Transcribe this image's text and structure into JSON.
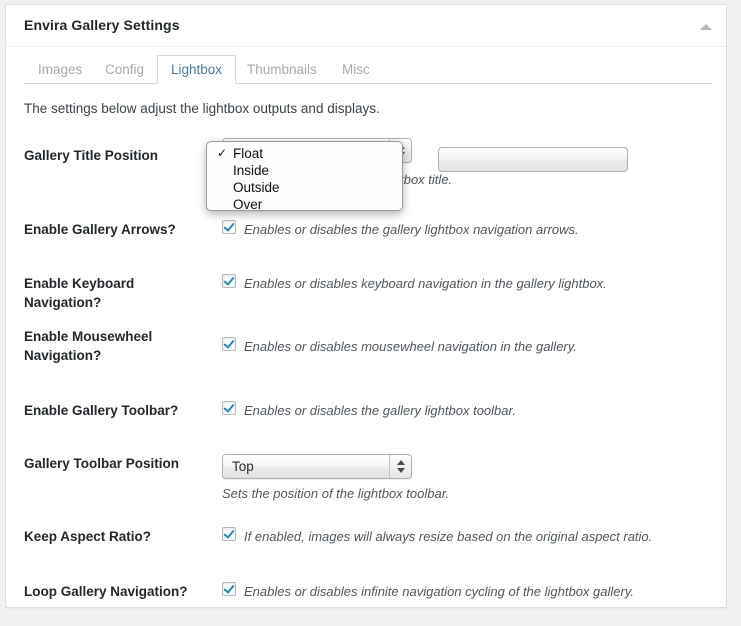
{
  "panel": {
    "title": "Envira Gallery Settings",
    "toggle_icon": "collapse-triangle-up-icon"
  },
  "tabs": [
    {
      "label": "Images",
      "active": false
    },
    {
      "label": "Config",
      "active": false
    },
    {
      "label": "Lightbox",
      "active": true
    },
    {
      "label": "Thumbnails",
      "active": false
    },
    {
      "label": "Misc",
      "active": false
    }
  ],
  "intro": "The settings below adjust the lightbox outputs and displays.",
  "settings": [
    {
      "label": "Gallery Title Position",
      "type": "select-open",
      "value": "Float",
      "hint": "Sets the position of the lightbox title.",
      "options": [
        {
          "label": "Float",
          "selected": true
        },
        {
          "label": "Inside",
          "selected": false
        },
        {
          "label": "Outside",
          "selected": false
        },
        {
          "label": "Over",
          "selected": false
        }
      ]
    },
    {
      "label": "Enable Gallery Arrows?",
      "type": "checkbox",
      "checked": true,
      "hint": "Enables or disables the gallery lightbox navigation arrows."
    },
    {
      "label": "Enable Keyboard Navigation?",
      "type": "checkbox",
      "checked": true,
      "hint": "Enables or disables keyboard navigation in the gallery lightbox."
    },
    {
      "label": "Enable Mousewheel Navigation?",
      "type": "checkbox",
      "checked": true,
      "hint": "Enables or disables mousewheel navigation in the gallery."
    },
    {
      "label": "Enable Gallery Toolbar?",
      "type": "checkbox",
      "checked": true,
      "hint": "Enables or disables the gallery lightbox toolbar."
    },
    {
      "label": "Gallery Toolbar Position",
      "type": "select",
      "value": "Top",
      "hint": "Sets the position of the lightbox toolbar."
    },
    {
      "label": "Keep Aspect Ratio?",
      "type": "checkbox",
      "checked": true,
      "hint": "If enabled, images will always resize based on the original aspect ratio."
    },
    {
      "label": "Loop Gallery Navigation?",
      "type": "checkbox",
      "checked": true,
      "hint": "Enables or disables infinite navigation cycling of the lightbox gallery."
    }
  ],
  "colors": {
    "accent": "#4a7ba7",
    "checkmark": "#1e8cbe",
    "panel_bg": "#ffffff",
    "page_bg": "#f1f1f1",
    "label_text": "#23282d"
  },
  "checkmark_glyph": "✓"
}
